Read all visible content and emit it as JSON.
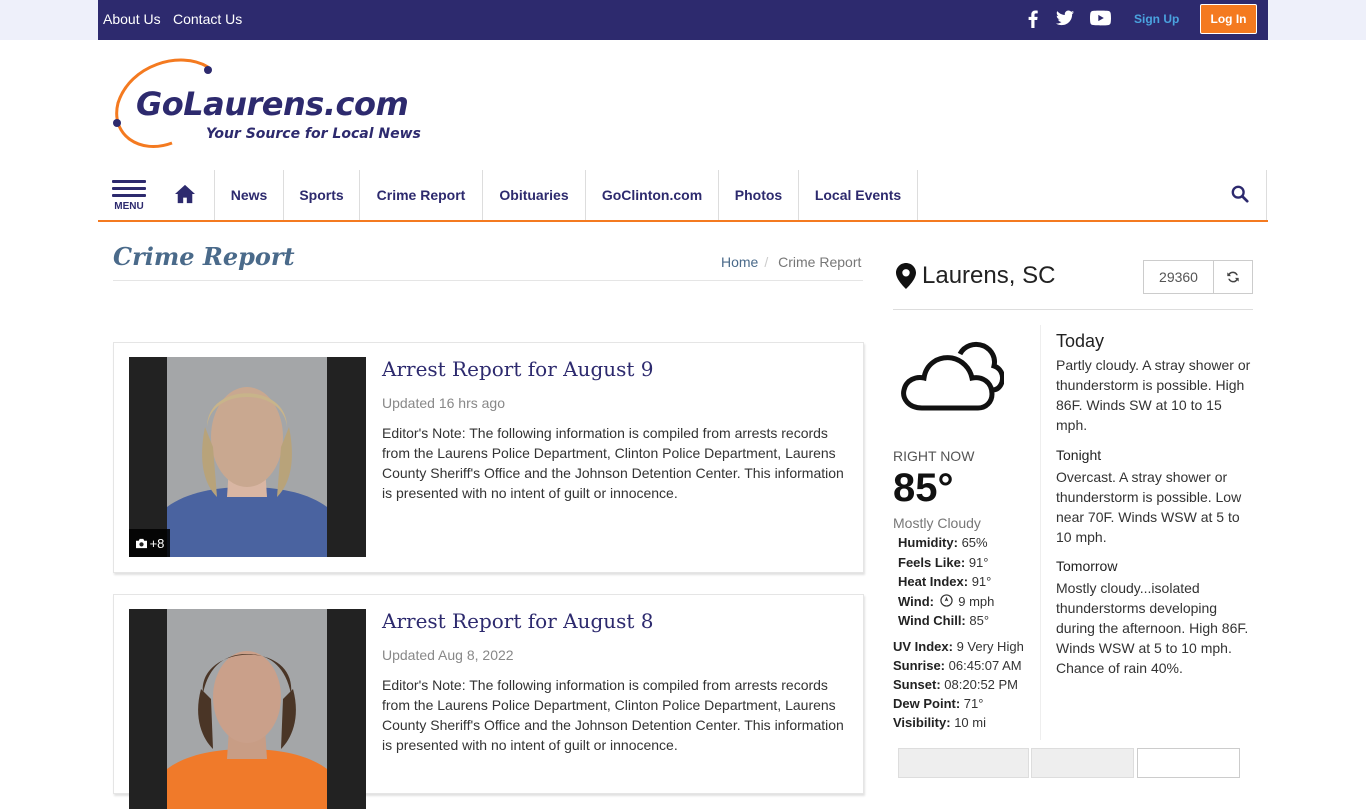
{
  "topbar": {
    "about": "About Us",
    "contact": "Contact Us",
    "signup": "Sign Up",
    "login": "Log In",
    "social": [
      "facebook-icon",
      "twitter-icon",
      "youtube-icon"
    ]
  },
  "logo": {
    "main": "GoLaurens.com",
    "tagline": "Your Source for Local News",
    "accent": "#f47a20",
    "brand": "#2d2a6e"
  },
  "nav": {
    "menu_label": "MENU",
    "items": [
      "News",
      "Sports",
      "Crime Report",
      "Obituaries",
      "GoClinton.com",
      "Photos",
      "Local Events"
    ]
  },
  "page": {
    "title": "Crime Report",
    "breadcrumb": [
      "Home",
      "Crime Report"
    ]
  },
  "articles": [
    {
      "title": "Arrest Report for August 9",
      "updated": "Updated 16 hrs ago",
      "summary": "Editor's Note: The following information is compiled from arrests records from the Laurens Police Department, Clinton Police Department, Laurens County Sheriff's Office and the Johnson Detention Center. This information is presented with no intent of guilt or innocence.",
      "photo_count": "+8"
    },
    {
      "title": "Arrest Report for August 8",
      "updated": "Updated Aug 8, 2022",
      "summary": "Editor's Note: The following information is compiled from arrests records from the Laurens Police Department, Clinton Police Department, Laurens County Sheriff's Office and the Johnson Detention Center. This information is presented with no intent of guilt or innocence."
    }
  ],
  "weather": {
    "location": "Laurens, SC",
    "zip": "29360",
    "right_now_label": "RIGHT NOW",
    "temp": "85°",
    "condition": "Mostly Cloudy",
    "stats": [
      {
        "label": "Humidity:",
        "value": "65%"
      },
      {
        "label": "Feels Like:",
        "value": "91°"
      },
      {
        "label": "Heat Index:",
        "value": "91°"
      },
      {
        "label": "Wind:",
        "value": "9 mph"
      },
      {
        "label": "Wind Chill:",
        "value": "85°"
      }
    ],
    "stats2": [
      {
        "label": "UV Index:",
        "value": "9 Very High"
      },
      {
        "label": "Sunrise:",
        "value": "06:45:07 AM"
      },
      {
        "label": "Sunset:",
        "value": "08:20:52 PM"
      },
      {
        "label": "Dew Point:",
        "value": "71°"
      },
      {
        "label": "Visibility:",
        "value": "10 mi"
      }
    ],
    "forecast": [
      {
        "period": "Today",
        "text": "Partly cloudy. A stray shower or thunderstorm is possible. High 86F. Winds SW at 10 to 15 mph."
      },
      {
        "period": "Tonight",
        "text": "Overcast. A stray shower or thunderstorm is possible. Low near 70F. Winds WSW at 5 to 10 mph."
      },
      {
        "period": "Tomorrow",
        "text": "Mostly cloudy...isolated thunderstorms developing during the afternoon. High 86F. Winds WSW at 5 to 10 mph. Chance of rain 40%."
      }
    ]
  }
}
